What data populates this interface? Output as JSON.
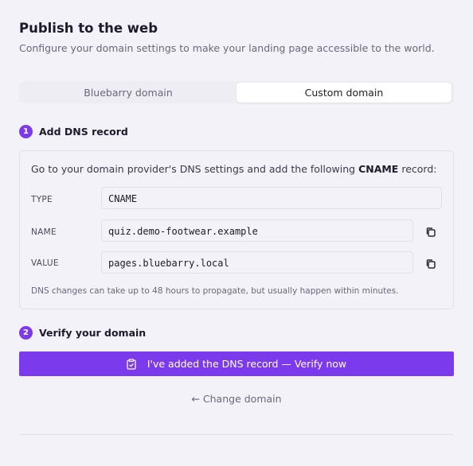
{
  "header": {
    "title": "Publish to the web",
    "subtitle": "Configure your domain settings to make your landing page accessible to the world."
  },
  "tabs": [
    {
      "label": "Bluebarry domain",
      "selected": false
    },
    {
      "label": "Custom domain",
      "selected": true
    }
  ],
  "step1": {
    "number": "1",
    "label": "Add DNS record",
    "intro_prefix": "Go to your domain provider's DNS settings and add the following ",
    "intro_bold": "CNAME",
    "intro_suffix": " record:",
    "rows": [
      {
        "label": "TYPE",
        "value": "CNAME"
      },
      {
        "label": "NAME",
        "value": "quiz.demo-footwear.example"
      },
      {
        "label": "VALUE",
        "value": "pages.bluebarry.local"
      }
    ],
    "note": "DNS changes can take up to 48 hours to propagate, but usually happen within minutes."
  },
  "step2": {
    "number": "2",
    "label": "Verify your domain",
    "button_label": "I've added the DNS record — Verify now"
  },
  "change_domain": "← Change domain",
  "colors": {
    "accent": "#7c3aed",
    "background": "#f3f2f8",
    "border": "#e2e1ea"
  },
  "icons": {
    "copy": "copy-icon",
    "verify": "clipboard-check-icon"
  }
}
